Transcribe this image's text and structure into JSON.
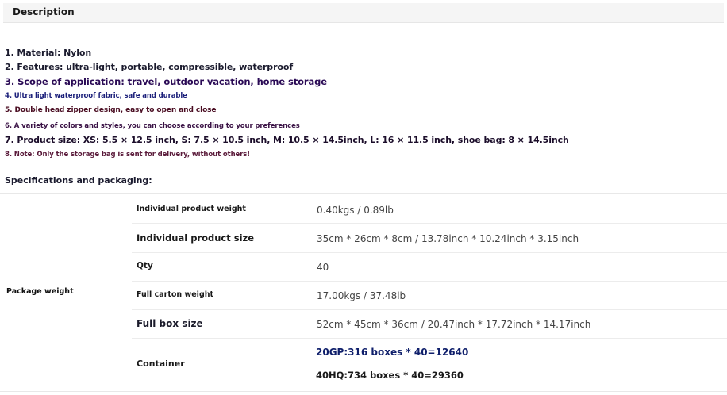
{
  "description": {
    "title": "Description"
  },
  "features": [
    "1. Material: Nylon",
    "2. Features: ultra-light, portable, compressible, waterproof",
    "3. Scope of application: travel, outdoor vacation, home storage",
    "4. Ultra light waterproof fabric, safe and durable",
    "5. Double head zipper design, easy to open and close",
    "6. A variety of colors and styles, you can choose according to your preferences",
    "7. Product size: XS: 5.5 × 12.5 inch, S: 7.5 × 10.5 inch, M: 10.5 × 14.5inch, L: 16 × 11.5 inch, shoe bag: 8 × 14.5inch",
    "8. Note: Only the storage bag is sent for delivery, without others!"
  ],
  "specs": {
    "heading": "Specifications and packaging:",
    "group_label": "Package weight",
    "rows": [
      {
        "key": "Individual product weight",
        "value": "0.40kgs / 0.89lb"
      },
      {
        "key": "Individual product size",
        "value": "35cm * 26cm * 8cm / 13.78inch * 10.24inch * 3.15inch"
      },
      {
        "key": "Qty",
        "value": "40"
      },
      {
        "key": "Full carton weight",
        "value": "17.00kgs / 37.48lb"
      },
      {
        "key": "Full box size",
        "value": "52cm * 45cm * 36cm / 20.47inch * 17.72inch * 14.17inch"
      }
    ],
    "container": {
      "key": "Container",
      "values": [
        "20GP:316 boxes * 40=12640",
        "40HQ:734 boxes * 40=29360"
      ]
    }
  }
}
